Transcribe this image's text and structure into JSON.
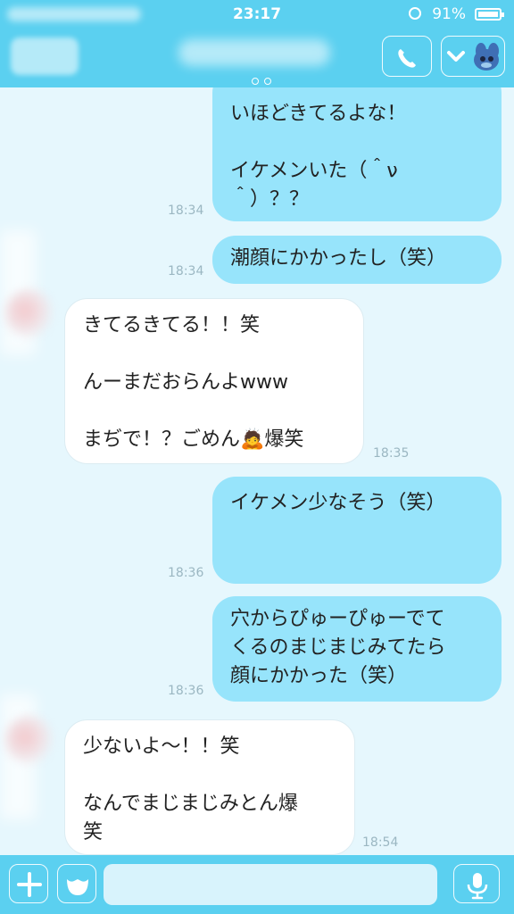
{
  "status_bar": {
    "time": "23:17",
    "battery": "91%"
  },
  "colors": {
    "header": "#5bd0f0",
    "sent_bubble": "#97e4fb",
    "received_bubble": "#ffffff",
    "background": "#e6f7fd"
  },
  "header": {
    "call_icon": "phone-icon",
    "menu_icon": "chevron-down-icon"
  },
  "messages": [
    {
      "direction": "sent",
      "text": "いほどきてるよな！\n\nイケメンいた（＾ν\n＾）？？",
      "time": "18:34"
    },
    {
      "direction": "sent",
      "text": "潮顔にかかったし（笑）",
      "time": "18:34"
    },
    {
      "direction": "received",
      "text": "きてるきてる！！笑\n\nんーまだおらんよwww\n\nまぢで！？ごめん🙇爆笑",
      "time": "18:35"
    },
    {
      "direction": "sent",
      "text": "イケメン少なそう（笑）",
      "time": "18:36"
    },
    {
      "direction": "sent",
      "text": "穴からぴゅーぴゅーでて\nくるのまじまじみてたら\n顔にかかった（笑）",
      "time": "18:36"
    },
    {
      "direction": "received",
      "text": "少ないよ〜！！笑\n\nなんでまじまじみとん爆\n笑",
      "time": "18:54"
    }
  ],
  "input_bar": {
    "plus_icon": "plus-icon",
    "sticker_icon": "sticker-icon",
    "mic_icon": "mic-icon",
    "placeholder": ""
  }
}
